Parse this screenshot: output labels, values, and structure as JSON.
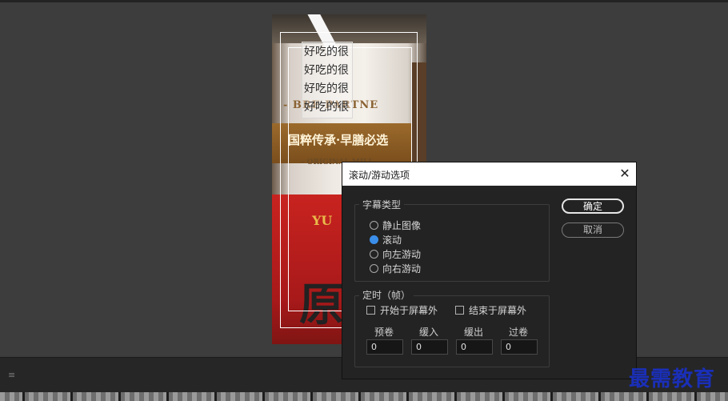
{
  "preview": {
    "title_lines": [
      "好吃的很",
      "好吃的很",
      "好吃的很",
      "好吃的很"
    ],
    "cup_print": {
      "partner": "- BRE    PARTNE",
      "slogan": "国粹传承·早膳必选",
      "mill": "– ORIGINAL MILL",
      "yu": "YU",
      "big": "原"
    }
  },
  "dialog": {
    "title": "滚动/游动选项",
    "close_glyph": "✕",
    "type_group": {
      "legend": "字幕类型",
      "options": [
        {
          "label": "静止图像",
          "selected": false
        },
        {
          "label": "滚动",
          "selected": true
        },
        {
          "label": "向左游动",
          "selected": false
        },
        {
          "label": "向右游动",
          "selected": false
        }
      ]
    },
    "timing_group": {
      "legend": "定时（帧）",
      "start_offscreen": {
        "label": "开始于屏幕外",
        "checked": false
      },
      "end_offscreen": {
        "label": "结束于屏幕外",
        "checked": false
      },
      "preroll": {
        "label": "预卷",
        "value": "0"
      },
      "ease_in": {
        "label": "缓入",
        "value": "0"
      },
      "ease_out": {
        "label": "缓出",
        "value": "0"
      },
      "postroll": {
        "label": "过卷",
        "value": "0"
      }
    },
    "ok_label": "确定",
    "cancel_label": "取消",
    "accent_color": "#3b8eea"
  },
  "bottom": {
    "menu_icon": "≡"
  },
  "watermark": "最需教育"
}
